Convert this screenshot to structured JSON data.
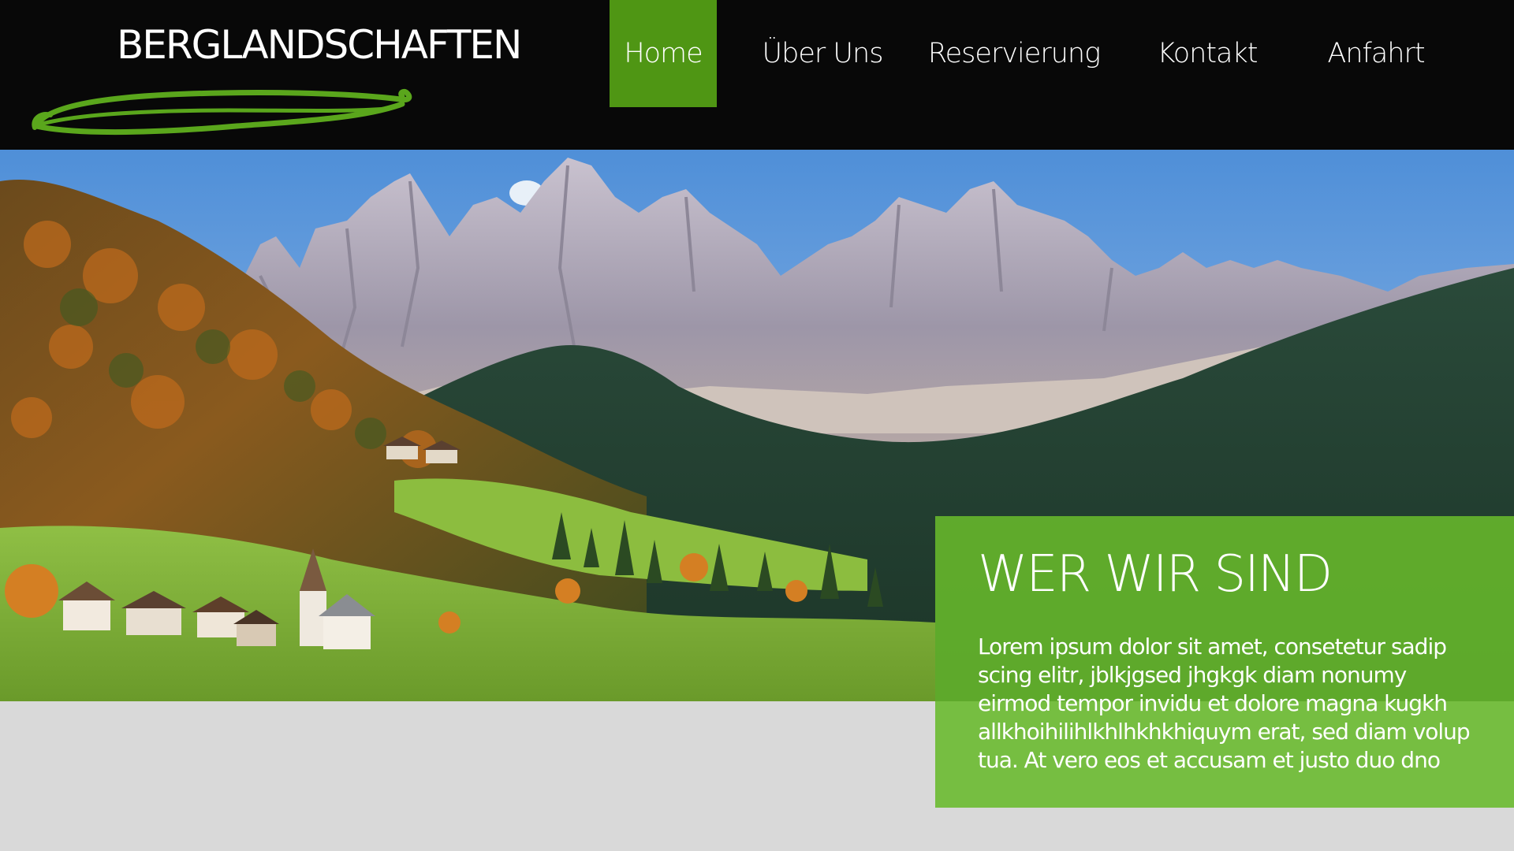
{
  "brand": {
    "logo_text": "BERGLANDSCHAFTEN",
    "accent_color": "#4f9614"
  },
  "nav": {
    "items": [
      {
        "label": "Home",
        "active": true
      },
      {
        "label": "Über Uns",
        "active": false
      },
      {
        "label": "Reservierung",
        "active": false
      },
      {
        "label": "Kontakt",
        "active": false
      },
      {
        "label": "Anfahrt",
        "active": false
      }
    ]
  },
  "hero": {
    "image_subject": "mountain-landscape"
  },
  "info": {
    "title": "WER WIR SIND",
    "text": "Lorem ipsum dolor sit amet, consetetur sadip scing elitr, jblkjgsed jhgkgk diam nonumy eirmod tempor invidu et dolore magna kugkh allkhoihilihlkhlhkhkhiquym erat, sed diam volup tua. At vero eos et accusam et justo duo dno",
    "box_color": "#68ba2b"
  }
}
